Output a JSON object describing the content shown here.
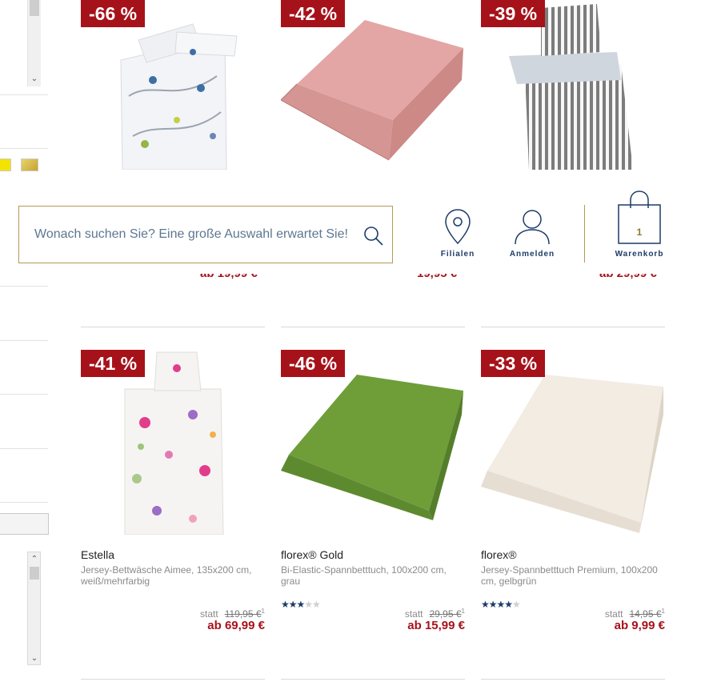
{
  "header": {
    "search_placeholder": "Wonach suchen Sie? Eine große Auswahl erwartet Sie!",
    "stores_label": "Filialen",
    "login_label": "Anmelden",
    "cart_label": "Warenkorb",
    "cart_count": "1"
  },
  "colors": {
    "accent": "#a6121a",
    "navy": "#1d3c66",
    "gold": "#b39a55"
  },
  "top_row": [
    {
      "badge": "-66 %",
      "partial_price": "ab 19,99 €"
    },
    {
      "badge": "-42 %",
      "partial_price": "19,95 €"
    },
    {
      "badge": "-39 %",
      "partial_price": "ab 29,99 €"
    }
  ],
  "products": [
    {
      "badge": "-41 %",
      "brand": "Estella",
      "description": "Jersey-Bettwäsche Aimee, 135x200 cm, weiß/mehrfarbig",
      "rating": null,
      "statt": "statt",
      "old_price": "119,95 €",
      "footnote": "1",
      "price": "ab 69,99 €"
    },
    {
      "badge": "-46 %",
      "brand": "florex® Gold",
      "description": "Bi-Elastic-Spannbetttuch, 100x200 cm, grau",
      "rating": 3,
      "statt": "statt",
      "old_price": "29,95 €",
      "footnote": "1",
      "price": "ab 15,99 €"
    },
    {
      "badge": "-33 %",
      "brand": "florex®",
      "description": "Jersey-Spannbetttuch Premium, 100x200 cm, gelbgrün",
      "rating": 4,
      "statt": "statt",
      "old_price": "14,95 €",
      "footnote": "1",
      "price": "ab 9,99 €"
    }
  ]
}
